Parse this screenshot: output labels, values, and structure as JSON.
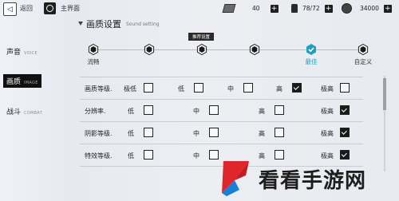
{
  "topbar": {
    "back_label": "返回",
    "home_label": "主界面",
    "resources": [
      {
        "icon": "supply-pack-icon",
        "value": "40"
      },
      {
        "icon": "fuel-icon",
        "value": "78/72"
      },
      {
        "icon": "coin-icon",
        "value": "34000"
      }
    ]
  },
  "sidebar": {
    "tabs": [
      {
        "label": "声音",
        "sub": "VOICE"
      },
      {
        "label": "画质",
        "sub": "IMAGE"
      },
      {
        "label": "战斗",
        "sub": "COMBAT"
      }
    ],
    "active_index": 1
  },
  "section": {
    "title": "画质设置",
    "subtitle": "Sound setting"
  },
  "presets": {
    "tooltip": "推荐设置",
    "nodes": [
      {
        "label": "流畅"
      },
      {
        "label": ""
      },
      {
        "label": ""
      },
      {
        "label": ""
      },
      {
        "label": "最佳"
      },
      {
        "label": "自定义"
      }
    ],
    "selected_index": 4,
    "accent_color": "#1fa0c0"
  },
  "settings": {
    "rows": [
      {
        "label": "画质等级.",
        "options": [
          {
            "label": "极低",
            "checked": false
          },
          {
            "label": "低",
            "checked": false
          },
          {
            "label": "中",
            "checked": false
          },
          {
            "label": "高",
            "checked": true
          },
          {
            "label": "极高",
            "checked": false
          }
        ]
      },
      {
        "label": "分辨率.",
        "options": [
          {
            "label": "低",
            "checked": false
          },
          {
            "label": "中",
            "checked": false
          },
          {
            "label": "高",
            "checked": false
          },
          {
            "label": "极高",
            "checked": true
          }
        ]
      },
      {
        "label": "阴影等级.",
        "options": [
          {
            "label": "低",
            "checked": false
          },
          {
            "label": "中",
            "checked": false
          },
          {
            "label": "高",
            "checked": false
          },
          {
            "label": "极高",
            "checked": true
          }
        ]
      },
      {
        "label": "特效等级.",
        "options": [
          {
            "label": "低",
            "checked": false
          },
          {
            "label": "中",
            "checked": false
          },
          {
            "label": "高",
            "checked": false
          },
          {
            "label": "极高",
            "checked": true
          }
        ]
      }
    ]
  },
  "watermark": {
    "text": "看看手游网"
  }
}
